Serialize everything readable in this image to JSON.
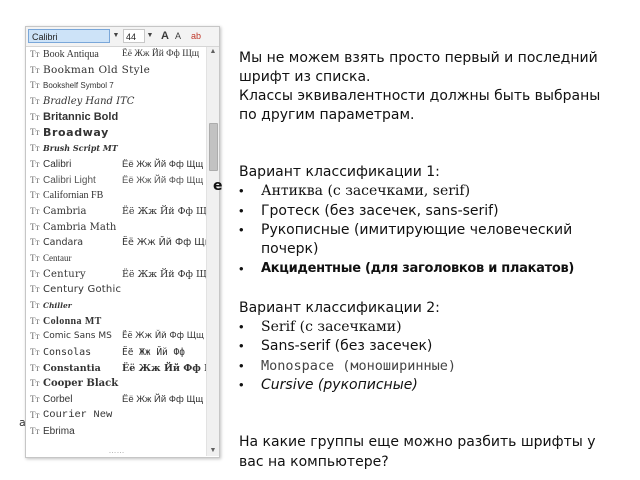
{
  "font_picker": {
    "font_name": "Calibri",
    "font_size": "44",
    "toolbar_icons": [
      "A",
      "A",
      "ab"
    ],
    "more_indicator": "……",
    "fonts": [
      {
        "name": "Book Antiqua",
        "sample": "Ёё Жж Йй Фф Щщ",
        "css": "font-family:'Liberation Serif',serif;font-size:10px;",
        "sample_css": "font-family:'Liberation Serif',serif;"
      },
      {
        "name": "Bookman Old Style",
        "sample": "",
        "css": "font-family:'DejaVu Serif',serif;font-size:10.5px;letter-spacing:0.3px;"
      },
      {
        "name": "Bookshelf Symbol 7",
        "sample": "",
        "css": "font-family:'Liberation Sans',sans-serif;font-size:8px;"
      },
      {
        "name": "Bradley Hand ITC",
        "sample": "",
        "css": "font-family:'DejaVu Serif',serif;font-style:italic;font-size:10px;"
      },
      {
        "name": "Britannic Bold",
        "sample": "",
        "css": "font-family:'Liberation Sans',sans-serif;font-weight:bold;font-size:11px;"
      },
      {
        "name": "Broadway",
        "sample": "",
        "css": "font-family:'DejaVu Sans',sans-serif;font-weight:bold;font-size:11px;letter-spacing:0.6px;"
      },
      {
        "name": "Brush Script MT",
        "sample": "",
        "css": "font-family:'DejaVu Serif',serif;font-style:italic;font-weight:bold;font-size:8px;"
      },
      {
        "name": "Calibri",
        "sample": "Ёё Жж Йй Фф Щщ",
        "css": "font-family:'Liberation Sans',sans-serif;font-size:10px;",
        "sample_css": "font-family:'Liberation Sans',sans-serif;"
      },
      {
        "name": "Calibri Light",
        "sample": "Ёё Жж Йй Фф Щщ",
        "css": "font-family:'Liberation Sans',sans-serif;font-size:10px;color:#555;",
        "sample_css": "font-family:'Liberation Sans',sans-serif;color:#555;"
      },
      {
        "name": "Californian FB",
        "sample": "",
        "css": "font-family:'Liberation Serif',serif;font-size:10px;"
      },
      {
        "name": "Cambria",
        "sample": "Ёё Жж Йй Фф Щщ",
        "css": "font-family:'DejaVu Serif',serif;font-size:10px;",
        "sample_css": "font-family:'DejaVu Serif',serif;"
      },
      {
        "name": "Cambria Math",
        "sample": "",
        "css": "font-family:'DejaVu Serif',serif;font-size:10px;"
      },
      {
        "name": "Candara",
        "sample": "Ёё Жж Йй Фф Щщ",
        "css": "font-family:'DejaVu Sans',sans-serif;font-size:9.5px;",
        "sample_css": "font-family:'DejaVu Sans',sans-serif;"
      },
      {
        "name": "Centaur",
        "sample": "",
        "css": "font-family:'Liberation Serif',serif;font-size:9px;"
      },
      {
        "name": "Century",
        "sample": "Ёё Жж Йй Фф Щщ",
        "css": "font-family:'DejaVu Serif',serif;font-size:10px;letter-spacing:0.3px;",
        "sample_css": "font-family:'DejaVu Serif',serif;"
      },
      {
        "name": "Century Gothic",
        "sample": "",
        "css": "font-family:'DejaVu Sans',sans-serif;font-size:10px;letter-spacing:0.2px;"
      },
      {
        "name": "Chiller",
        "sample": "",
        "css": "font-family:'DejaVu Serif',serif;font-style:italic;font-weight:bold;font-size:7.5px;"
      },
      {
        "name": "Colonna MT",
        "sample": "",
        "css": "font-family:'Liberation Serif',serif;font-weight:bold;font-size:10px;letter-spacing:0.4px;"
      },
      {
        "name": "Comic Sans MS",
        "sample": "Ёё Жж Йй Фф Щщ",
        "css": "font-family:'DejaVu Sans',sans-serif;font-size:9px;",
        "sample_css": "font-family:'DejaVu Sans',sans-serif;font-size:8.5px;"
      },
      {
        "name": "Consolas",
        "sample": "Ёё Жж Йй Фф",
        "css": "font-family:'DejaVu Sans Mono',monospace;font-size:10px;",
        "sample_css": "font-family:'DejaVu Sans Mono',monospace;"
      },
      {
        "name": "Constantia",
        "sample": "Ёё Жж Йй Фф Щщ",
        "css": "font-family:'DejaVu Serif',serif;font-weight:bold;font-size:9.5px;",
        "sample_css": "font-family:'DejaVu Serif',serif;font-weight:bold;"
      },
      {
        "name": "Cooper Black",
        "sample": "",
        "css": "font-family:'DejaVu Serif',serif;font-weight:bold;font-size:10px;"
      },
      {
        "name": "Corbel",
        "sample": "Ёё Жж Йй Фф Щщ",
        "css": "font-family:'Liberation Sans',sans-serif;font-size:10px;",
        "sample_css": "font-family:'Liberation Sans',sans-serif;"
      },
      {
        "name": "Courier New",
        "sample": "",
        "css": "font-family:'Liberation Mono',monospace;font-size:10.5px;"
      },
      {
        "name": "Ebrima",
        "sample": "",
        "css": "font-family:'Liberation Sans',sans-serif;font-size:10px;"
      }
    ]
  },
  "slide": {
    "intro_line1": "Мы не можем взять просто первый и последний",
    "intro_line2": "шрифт из списка.",
    "intro_line3": "Классы эквивалентности должны быть выбраны",
    "intro_line4": "по другим параметрам.",
    "variant1_title": "Вариант классификации 1:",
    "variant1_items": [
      "Антиква (с засечками, serif)",
      "Гротеск (без засечек, sans-serif)",
      "Рукописные (имитирующие человеческий",
      "почерк)",
      "Акцидентные (для заголовков и плакатов)"
    ],
    "variant2_title": "Вариант классификации 2:",
    "variant2_items": [
      "Serif (с засечками)",
      "Sans-serif (без засечек)",
      "Monospace (моноширинные)",
      "Cursive (рукописные)"
    ],
    "question_line1": "На какие группы еще можно разбить шрифты у",
    "question_line2": "вас на компьютере?",
    "bullet_char": "•",
    "side_glyph": "е",
    "side_a": "а"
  }
}
